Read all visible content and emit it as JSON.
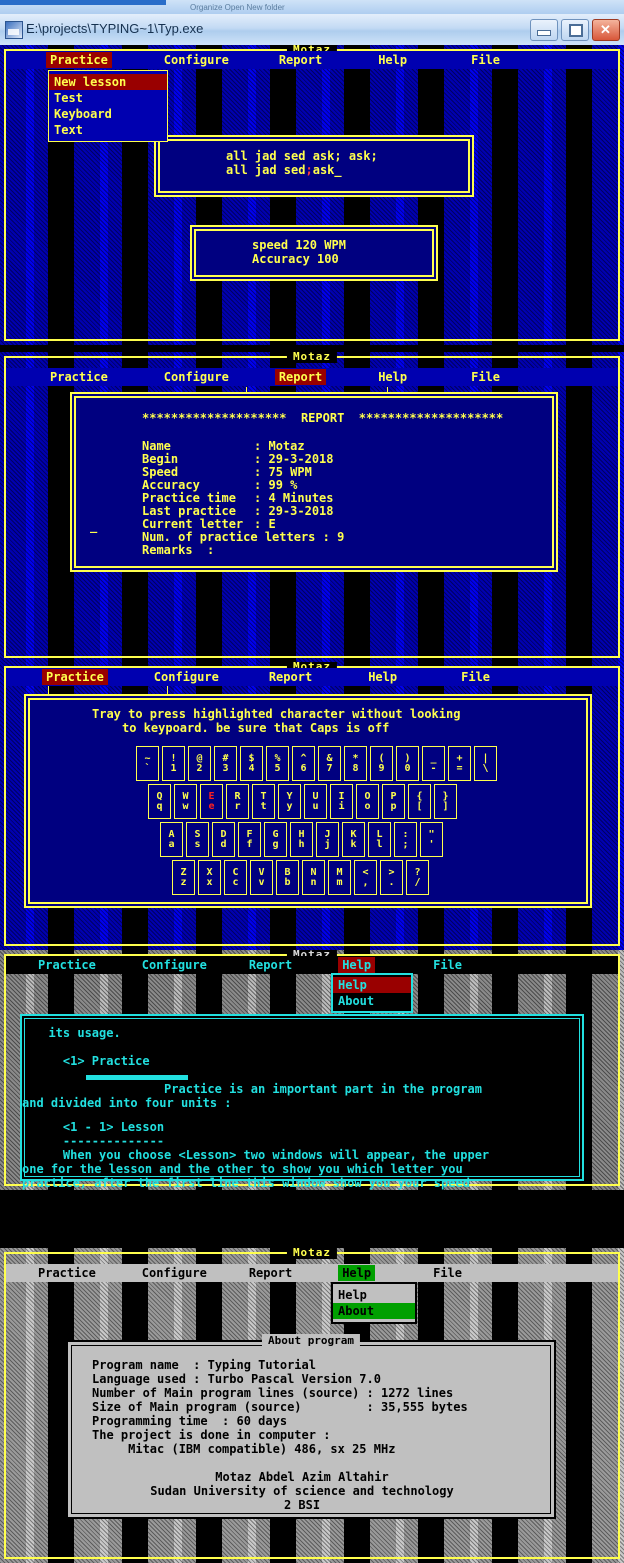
{
  "window": {
    "title": "E:\\projects\\TYPING~1\\Typ.exe",
    "ghost_text": "Organize     Open     New folder",
    "minimize_label": "_",
    "maximize_label": "□",
    "close_label": "✕"
  },
  "app": {
    "title": "Motaz"
  },
  "menu": {
    "practice": "Practice",
    "configure": "Configure",
    "report": "Report",
    "help": "Help",
    "file": "File"
  },
  "panel1": {
    "dropdown": {
      "items": [
        "New lesson",
        "Test",
        "Keyboard",
        "Text"
      ],
      "selected": "New lesson"
    },
    "lesson": {
      "line1": "all jad sed ask; ask;",
      "line2_a": "all jad sed",
      "line2_semi": ";",
      "line2_b": "ask_"
    },
    "stats": {
      "speed": "speed 120 WPM",
      "accuracy": "Accuracy 100"
    }
  },
  "panel2": {
    "report": {
      "stars_left": "********************",
      "heading": "REPORT",
      "stars_right": "********************",
      "rows": [
        {
          "label": "Name",
          "sep": ":",
          "value": "Motaz"
        },
        {
          "label": "Begin",
          "sep": ":",
          "value": "29-3-2018"
        },
        {
          "label": "Speed",
          "sep": ":",
          "value": "75 WPM"
        },
        {
          "label": "Accuracy",
          "sep": ":",
          "value": "99 %"
        },
        {
          "label": "Practice time",
          "sep": ":",
          "value": "4 Minutes"
        },
        {
          "label": "Last practice",
          "sep": ":",
          "value": "29-3-2018"
        },
        {
          "label": "Current letter",
          "sep": ":",
          "value": "E"
        }
      ],
      "num_letters_line": "Num. of practice letters : 9",
      "remarks_line": "Remarks  :",
      "cursor": "_"
    }
  },
  "panel3": {
    "instruction_line1": "Tray to press highlighted character without looking",
    "instruction_line2": "to keypoard. be sure that Caps is off",
    "active_key": "E",
    "rows": [
      {
        "keys": [
          {
            "top": "~",
            "bottom": "`"
          },
          {
            "top": "!",
            "bottom": "1"
          },
          {
            "top": "@",
            "bottom": "2"
          },
          {
            "top": "#",
            "bottom": "3"
          },
          {
            "top": "$",
            "bottom": "4"
          },
          {
            "top": "%",
            "bottom": "5"
          },
          {
            "top": "^",
            "bottom": "6"
          },
          {
            "top": "&",
            "bottom": "7"
          },
          {
            "top": "*",
            "bottom": "8"
          },
          {
            "top": "(",
            "bottom": "9"
          },
          {
            "top": ")",
            "bottom": "0"
          },
          {
            "top": "_",
            "bottom": "-"
          },
          {
            "top": "+",
            "bottom": "="
          },
          {
            "top": "|",
            "bottom": "\\"
          }
        ]
      },
      {
        "keys": [
          {
            "top": "Q",
            "bottom": "q"
          },
          {
            "top": "W",
            "bottom": "w"
          },
          {
            "top": "E",
            "bottom": "e"
          },
          {
            "top": "R",
            "bottom": "r"
          },
          {
            "top": "T",
            "bottom": "t"
          },
          {
            "top": "Y",
            "bottom": "y"
          },
          {
            "top": "U",
            "bottom": "u"
          },
          {
            "top": "I",
            "bottom": "i"
          },
          {
            "top": "O",
            "bottom": "o"
          },
          {
            "top": "P",
            "bottom": "p"
          },
          {
            "top": "{",
            "bottom": "["
          },
          {
            "top": "}",
            "bottom": "]"
          }
        ]
      },
      {
        "keys": [
          {
            "top": "A",
            "bottom": "a"
          },
          {
            "top": "S",
            "bottom": "s"
          },
          {
            "top": "D",
            "bottom": "d"
          },
          {
            "top": "F",
            "bottom": "f"
          },
          {
            "top": "G",
            "bottom": "g"
          },
          {
            "top": "H",
            "bottom": "h"
          },
          {
            "top": "J",
            "bottom": "j"
          },
          {
            "top": "K",
            "bottom": "k"
          },
          {
            "top": "L",
            "bottom": "l"
          },
          {
            "top": ":",
            "bottom": ";"
          },
          {
            "top": "\"",
            "bottom": "'"
          }
        ]
      },
      {
        "keys": [
          {
            "top": "Z",
            "bottom": "z"
          },
          {
            "top": "X",
            "bottom": "x"
          },
          {
            "top": "C",
            "bottom": "c"
          },
          {
            "top": "V",
            "bottom": "v"
          },
          {
            "top": "B",
            "bottom": "b"
          },
          {
            "top": "N",
            "bottom": "n"
          },
          {
            "top": "M",
            "bottom": "m"
          },
          {
            "top": "<",
            "bottom": ","
          },
          {
            "top": ">",
            "bottom": "."
          },
          {
            "top": "?",
            "bottom": "/"
          }
        ]
      }
    ]
  },
  "panel4": {
    "dropdown": {
      "items": [
        "Help",
        "About"
      ],
      "selected": "Help"
    },
    "body": {
      "l1": "  its usage.",
      "l2": "    <1> Practice",
      "l3_a": "                  Practice is an important part in the program",
      "l4": "and divided into four units :",
      "l5": "    <1 - 1> Lesson",
      "l6": "    --------------",
      "l7": "    When you choose <Lesson> two windows will appear, the upper",
      "l8": "one for the lesson and the other to show you which letter you",
      "l9": "practice, after the first line this window show you your speed"
    }
  },
  "panel5": {
    "dropdown": {
      "items": [
        "Help",
        "About"
      ],
      "selected": "About"
    },
    "about": {
      "title": "About program",
      "l1": "Program name  : Typing Tutorial",
      "l2": "Language used : Turbo Pascal Version 7.0",
      "l3": "Number of Main program lines (source) : 1272 lines",
      "l4": "Size of Main program (source)         : 35,555 bytes",
      "l5": "Programming time  : 60 days",
      "l6": "The project is done in computer :",
      "l7": "     Mitac (IBM compatible) 486, sx 25 MHz",
      "l8": "Motaz Abdel Azim Altahir",
      "l9": "Sudan University of science and technology",
      "l10": "2 BSI"
    }
  }
}
